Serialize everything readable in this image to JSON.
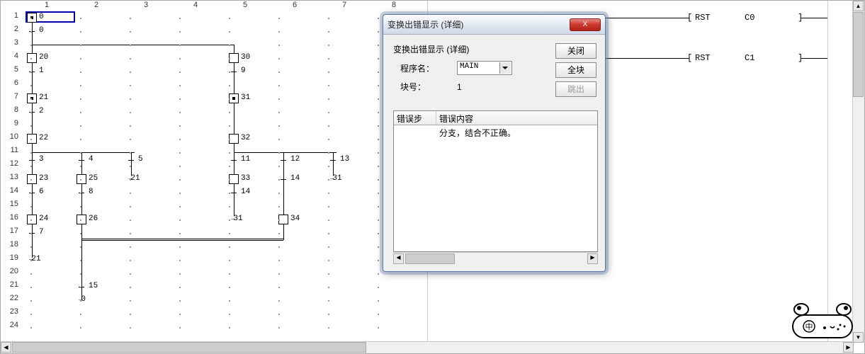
{
  "ruler_cols": [
    "1",
    "2",
    "3",
    "4",
    "5",
    "6",
    "7",
    "8"
  ],
  "ruler_rows": [
    "1",
    "2",
    "3",
    "4",
    "5",
    "6",
    "7",
    "8",
    "9",
    "10",
    "11",
    "12",
    "13",
    "14",
    "15",
    "16",
    "17",
    "18",
    "19",
    "20",
    "21",
    "22",
    "23",
    "24"
  ],
  "nodes": {
    "r1c1": "0",
    "r2c1": "0",
    "r4c1": "20",
    "r4c5": "30",
    "r5c1": "1",
    "r5c5": "9",
    "r7c1": "21",
    "r7c5": "31",
    "r8c1": "2",
    "r10c1": "22",
    "r10c5": "32",
    "r11c1": "3",
    "r11c2": "4",
    "r11c3": "5",
    "r11c5": "11",
    "r11c6": "12",
    "r11c7": "13",
    "r13c1": "23",
    "r13c2": "25",
    "r13c3": "21",
    "r13c5": "33",
    "r13c6": "14",
    "r13c7": "31",
    "r14c1": "6",
    "r14c2": "8",
    "r14c5": "14",
    "r16c1": "24",
    "r16c2": "26",
    "r16c5": "31",
    "r16c6": "34",
    "r17c1": "7",
    "r19c1": "21",
    "r21c2": "15",
    "r22c2": "0"
  },
  "rst": [
    {
      "op": "RST",
      "arg": "C0"
    },
    {
      "op": "RST",
      "arg": "C1"
    }
  ],
  "dialog": {
    "title": "变换出错显示 (详细)",
    "header": "变换出错显示 (详细)",
    "program_label": "程序名：",
    "program_value": "MAIN",
    "block_label": "块号：",
    "block_value": "1",
    "btn_close": "关闭",
    "btn_all": "全块",
    "btn_jump": "跳出",
    "col_step": "错误步",
    "col_content": "错误内容",
    "err_msg": "分支，结合不正确。",
    "close_x": "X"
  },
  "mascot_text": "中"
}
